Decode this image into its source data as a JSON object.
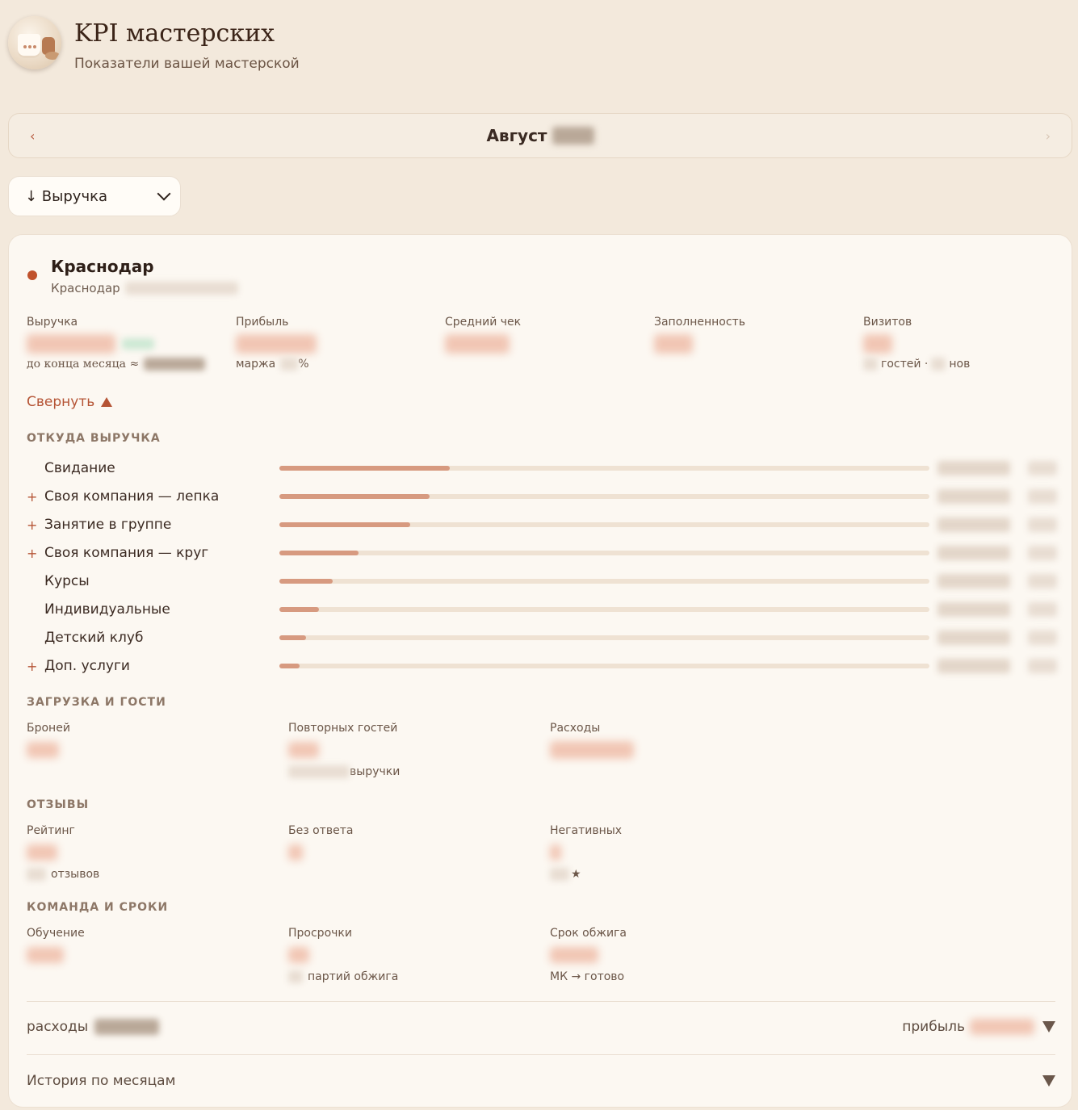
{
  "header": {
    "title": "KPI мастерских",
    "subtitle": "Показатели вашей мастерской"
  },
  "month": {
    "label": "Август",
    "prev_icon": "‹",
    "next_icon": "›"
  },
  "sort": {
    "selected": "↓ Выручка"
  },
  "studio": {
    "name": "Краснодар",
    "city": "Краснодар",
    "status_color": "#c0522c"
  },
  "kpis": {
    "revenue": {
      "label": "Выручка",
      "note": "до конца месяца ≈"
    },
    "profit": {
      "label": "Прибыль",
      "note_prefix": "маржа",
      "note_suffix": "%"
    },
    "avg_check": {
      "label": "Средний чек"
    },
    "occupancy": {
      "label": "Заполненность"
    },
    "visits": {
      "label": "Визитов",
      "note_a": "гостей ·",
      "note_b": "нов"
    }
  },
  "collapse_label": "Свернуть",
  "revenue_sources": {
    "title": "ОТКУДА ВЫРУЧКА",
    "items": [
      {
        "label": "Свидание",
        "plus": "",
        "share": 0.262
      },
      {
        "label": "Своя компания — лепка",
        "plus": "+",
        "share": 0.231
      },
      {
        "label": "Занятие в группе",
        "plus": "+",
        "share": 0.201
      },
      {
        "label": "Своя компания — круг",
        "plus": "+",
        "share": 0.122
      },
      {
        "label": "Курсы",
        "plus": "",
        "share": 0.082
      },
      {
        "label": "Индивидуальные",
        "plus": "",
        "share": 0.061
      },
      {
        "label": "Детский клуб",
        "plus": "",
        "share": 0.041
      },
      {
        "label": "Доп. услуги",
        "plus": "+",
        "share": 0.031
      }
    ]
  },
  "load": {
    "title": "ЗАГРУЗКА И ГОСТИ",
    "bookings": {
      "label": "Броней"
    },
    "repeat": {
      "label": "Повторных гостей",
      "note": "выручки"
    },
    "expenses": {
      "label": "Расходы"
    }
  },
  "reviews": {
    "title": "ОТЗЫВЫ",
    "rating": {
      "label": "Рейтинг",
      "note": "отзывов"
    },
    "unanswered": {
      "label": "Без ответа"
    },
    "negative": {
      "label": "Негативных",
      "note": "★"
    }
  },
  "team": {
    "title": "КОМАНДА И СРОКИ",
    "training": {
      "label": "Обучение"
    },
    "overdue": {
      "label": "Просрочки",
      "note": "партий обжига"
    },
    "firing": {
      "label": "Срок обжига",
      "note": "МК → готово"
    }
  },
  "footer": {
    "expenses_label": "расходы",
    "profit_label": "прибыль",
    "history_label": "История по месяцам"
  },
  "colors": {
    "accent": "#b55435",
    "bar_fill": "#d79a80",
    "bar_track": "#efe2d3",
    "background": "#f3e9dc",
    "card": "#fcf8f2"
  }
}
